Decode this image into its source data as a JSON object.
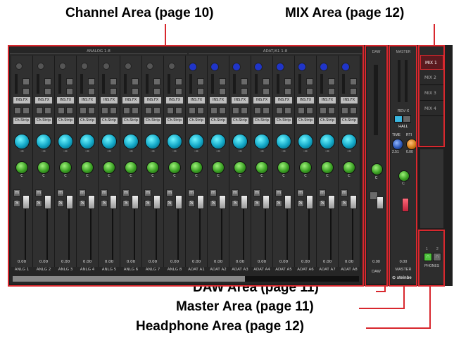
{
  "callouts": {
    "channel": "Channel Area (page 10)",
    "mix": "MIX Area (page 12)",
    "daw": "DAW Area (page 11)",
    "master": "Master Area (page 11)",
    "headphone": "Headphone Area (page 12)"
  },
  "channel_area": {
    "group_analog": "ANALOG 1-8",
    "group_adat": "ADAT/A1 1-8",
    "channels": [
      {
        "name": "ANLG 1",
        "ins": "INS.FX",
        "strip": "Ch.Strip",
        "pan": "-∞",
        "knob": "C",
        "vol": "0.00"
      },
      {
        "name": "ANLG 2",
        "ins": "INS.FX",
        "strip": "Ch.Strip",
        "pan": "-∞",
        "knob": "C",
        "vol": "0.00"
      },
      {
        "name": "ANLG 3",
        "ins": "INS.FX",
        "strip": "Ch.Strip",
        "pan": "-∞",
        "knob": "C",
        "vol": "0.00"
      },
      {
        "name": "ANLG 4",
        "ins": "INS.FX",
        "strip": "Ch.Strip",
        "pan": "-∞",
        "knob": "C",
        "vol": "0.00"
      },
      {
        "name": "ANLG 5",
        "ins": "INS.FX",
        "strip": "Ch.Strip",
        "pan": "-∞",
        "knob": "C",
        "vol": "0.00"
      },
      {
        "name": "ANLG 6",
        "ins": "INS.FX",
        "strip": "Ch.Strip",
        "pan": "-∞",
        "knob": "C",
        "vol": "0.00"
      },
      {
        "name": "ANLG 7",
        "ins": "INS.FX",
        "strip": "Ch.Strip",
        "pan": "-∞",
        "knob": "C",
        "vol": "0.00"
      },
      {
        "name": "ANLG 8",
        "ins": "INS.FX",
        "strip": "Ch.Strip",
        "pan": "-∞",
        "knob": "C",
        "vol": "0.00"
      },
      {
        "name": "ADAT A1",
        "ins": "INS.FX",
        "strip": "Ch.Strip",
        "pan": "-∞",
        "knob": "C",
        "vol": "0.00"
      },
      {
        "name": "ADAT A2",
        "ins": "INS.FX",
        "strip": "Ch.Strip",
        "pan": "-∞",
        "knob": "C",
        "vol": "0.00"
      },
      {
        "name": "ADAT A3",
        "ins": "INS.FX",
        "strip": "Ch.Strip",
        "pan": "-∞",
        "knob": "C",
        "vol": "0.00"
      },
      {
        "name": "ADAT A4",
        "ins": "INS.FX",
        "strip": "Ch.Strip",
        "pan": "-∞",
        "knob": "C",
        "vol": "0.00"
      },
      {
        "name": "ADAT A5",
        "ins": "INS.FX",
        "strip": "Ch.Strip",
        "pan": "-∞",
        "knob": "C",
        "vol": "0.00"
      },
      {
        "name": "ADAT A6",
        "ins": "INS.FX",
        "strip": "Ch.Strip",
        "pan": "-∞",
        "knob": "C",
        "vol": "0.00"
      },
      {
        "name": "ADAT A7",
        "ins": "INS.FX",
        "strip": "Ch.Strip",
        "pan": "-∞",
        "knob": "C",
        "vol": "0.00"
      },
      {
        "name": "ADAT A8",
        "ins": "INS.FX",
        "strip": "Ch.Strip",
        "pan": "-∞",
        "knob": "C",
        "vol": "0.00"
      }
    ],
    "mute": "m",
    "solo": "S"
  },
  "daw_area": {
    "title": "DAW",
    "name": "DAW",
    "vol": "0.00",
    "knob": "C"
  },
  "master_area": {
    "title": "MASTER",
    "rev": "REV-X",
    "rev_type": "HALL",
    "time_label": "TIME",
    "rt_label": "RTI",
    "time_value": "2.51",
    "rt_value": "0.00",
    "vol": "0.00",
    "name": "MASTER",
    "logo": "steinbe",
    "knob": "C"
  },
  "mix_area": {
    "buttons": [
      "MIX 1",
      "MIX 2",
      "MIX 3",
      "MIX 4"
    ]
  },
  "headphone_area": {
    "ch1": "1",
    "ch2": "2",
    "label": "PHONES"
  },
  "colors": {
    "accent_red": "#d8282e",
    "knob_blue": "#11a6c6",
    "knob_green": "#3a9f23",
    "fader_red": "#e0344a"
  }
}
